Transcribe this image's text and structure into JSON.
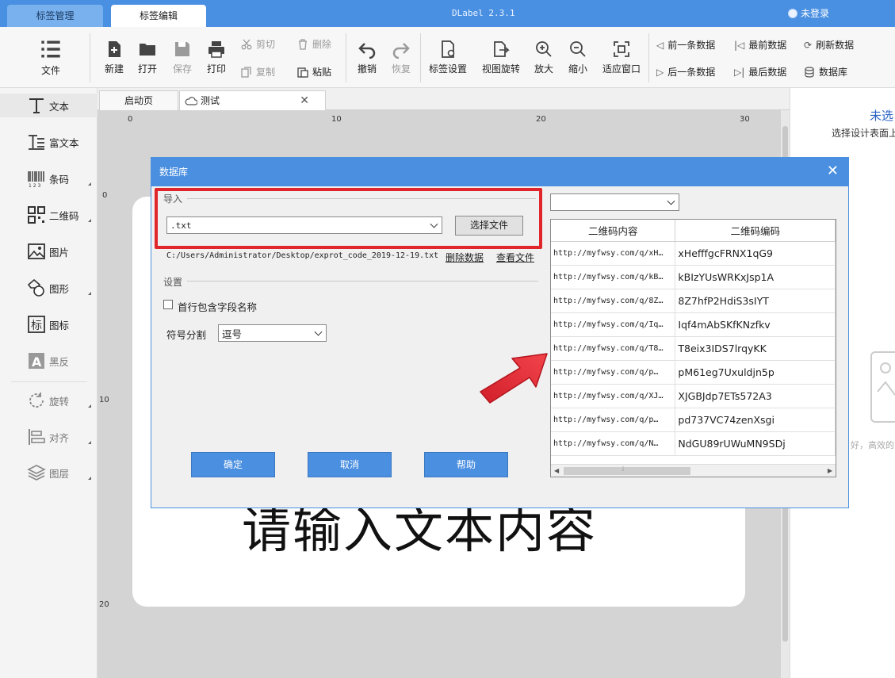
{
  "app": {
    "tabs": [
      "标签管理",
      "标签编辑"
    ],
    "title": "DLabel 2.3.1",
    "login": "未登录"
  },
  "toolbar": {
    "file": "文件",
    "new": "新建",
    "open": "打开",
    "save": "保存",
    "print": "打印",
    "cut": "剪切",
    "copy": "复制",
    "delete": "删除",
    "paste": "粘贴",
    "undo": "撤销",
    "redo": "恢复",
    "label_settings": "标签设置",
    "view_rotate": "视图旋转",
    "zoom_in": "放大",
    "zoom_out": "缩小",
    "fit_window": "适应窗口",
    "prev_record": "前一条数据",
    "next_record": "后一条数据",
    "first_record": "最前数据",
    "last_record": "最后数据",
    "refresh": "刷新数据",
    "database": "数据库"
  },
  "left_panel": {
    "items": [
      "文本",
      "富文本",
      "条码",
      "二维码",
      "图片",
      "图形",
      "图标",
      "黑反",
      "旋转",
      "对齐",
      "图层"
    ]
  },
  "doc_tabs": [
    "启动页",
    "测试"
  ],
  "ruler": {
    "top": [
      "0",
      "10",
      "20",
      "30"
    ],
    "left": [
      "0",
      "10",
      "20"
    ]
  },
  "canvas": {
    "big_text": "请输入文本内容"
  },
  "right_panel": {
    "title": "未选",
    "subtitle": "选择设计表面上",
    "tail": "好，高效的"
  },
  "dialog": {
    "title": "数据库",
    "import_group": "导入",
    "file_type": ".txt",
    "choose_file": "选择文件",
    "file_path": "C:/Users/Administrator/Desktop/exprot_code_2019-12-19.txt",
    "delete_data": "删除数据",
    "view_file": "查看文件",
    "settings_group": "设置",
    "first_row_header": "首行包含字段名称",
    "delimiter_label": "符号分割",
    "delimiter_value": "逗号",
    "ok": "确定",
    "cancel": "取消",
    "help": "帮助",
    "top_select": "",
    "table": {
      "headers": [
        "二维码内容",
        "二维码编码"
      ],
      "rows": [
        [
          "http://myfwsy.com/q/xH…",
          "xHefffgcFRNX1qG9"
        ],
        [
          "http://myfwsy.com/q/kB…",
          "kBIzYUsWRKxJsp1A"
        ],
        [
          "http://myfwsy.com/q/8Z…",
          "8Z7hfP2HdiS3sIYT"
        ],
        [
          "http://myfwsy.com/q/Iq…",
          "Iqf4mAbSKfKNzfkv"
        ],
        [
          "http://myfwsy.com/q/T8…",
          "T8eix3IDS7lrqyKK"
        ],
        [
          "http://myfwsy.com/q/p…",
          "pM61eg7Uxuldjn5p"
        ],
        [
          "http://myfwsy.com/q/XJ…",
          "XJGBJdp7ETs572A3"
        ],
        [
          "http://myfwsy.com/q/p…",
          "pd737VC74zenXsgi"
        ],
        [
          "http://myfwsy.com/q/N…",
          "NdGU89rUWuMN9SDj"
        ]
      ]
    }
  },
  "colors": {
    "accent": "#4a8fe0",
    "highlight": "#e0262b"
  }
}
